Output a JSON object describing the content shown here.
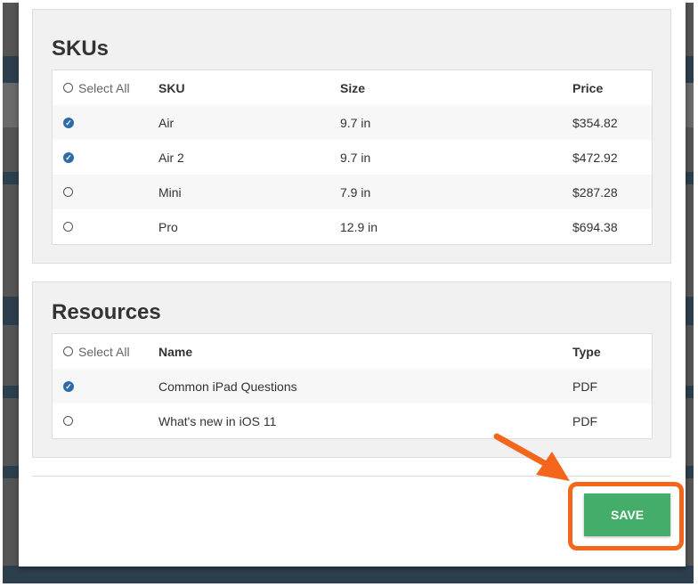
{
  "skus": {
    "title": "SKUs",
    "select_all": "Select All",
    "headers": [
      "SKU",
      "Size",
      "Price"
    ],
    "rows": [
      {
        "sku": "Air",
        "size": "9.7 in",
        "price": "$354.82",
        "checked": true
      },
      {
        "sku": "Air 2",
        "size": "9.7 in",
        "price": "$472.92",
        "checked": true
      },
      {
        "sku": "Mini",
        "size": "7.9 in",
        "price": "$287.28",
        "checked": false
      },
      {
        "sku": "Pro",
        "size": "12.9 in",
        "price": "$694.38",
        "checked": false
      }
    ]
  },
  "resources": {
    "title": "Resources",
    "select_all": "Select All",
    "headers": [
      "Name",
      "Type"
    ],
    "rows": [
      {
        "name": "Common iPad Questions",
        "type": "PDF",
        "checked": true
      },
      {
        "name": "What's new in iOS 11",
        "type": "PDF",
        "checked": false
      }
    ]
  },
  "save_label": "SAVE",
  "colors": {
    "accent": "#45ad6a",
    "check": "#2f6aa8",
    "annotation": "#f5661d"
  }
}
